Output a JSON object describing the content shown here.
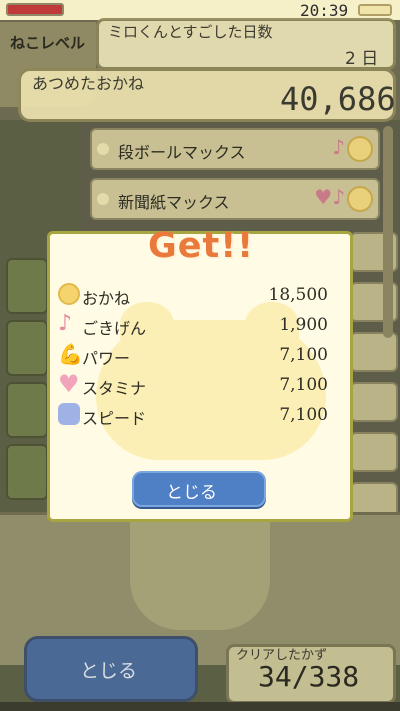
{
  "status_bar": {
    "time": "20:39"
  },
  "stats": {
    "level_label": "ねこレベル",
    "days_label": "ミロくんとすごした日数",
    "days_value": "2 日",
    "money_label": "あつめたおかね",
    "money_value": "40,686"
  },
  "list": {
    "items": [
      {
        "label": "段ボールマックス"
      },
      {
        "label": "新聞紙マックス"
      }
    ]
  },
  "modal": {
    "title": "Get!!",
    "rewards": [
      {
        "icon": "coin-icon",
        "label": "おかね",
        "value": "18,500"
      },
      {
        "icon": "music-note-icon",
        "label": "ごきげん",
        "value": "1,900"
      },
      {
        "icon": "muscle-arm-icon",
        "label": "パワー",
        "value": "7,100"
      },
      {
        "icon": "heart-icon",
        "label": "スタミナ",
        "value": "7,100"
      },
      {
        "icon": "paw-icon",
        "label": "スピード",
        "value": "7,100"
      }
    ],
    "close_label": "とじる"
  },
  "bottom": {
    "close_label": "とじる",
    "clear_label": "クリアしたかず",
    "clear_value": "34/338"
  }
}
